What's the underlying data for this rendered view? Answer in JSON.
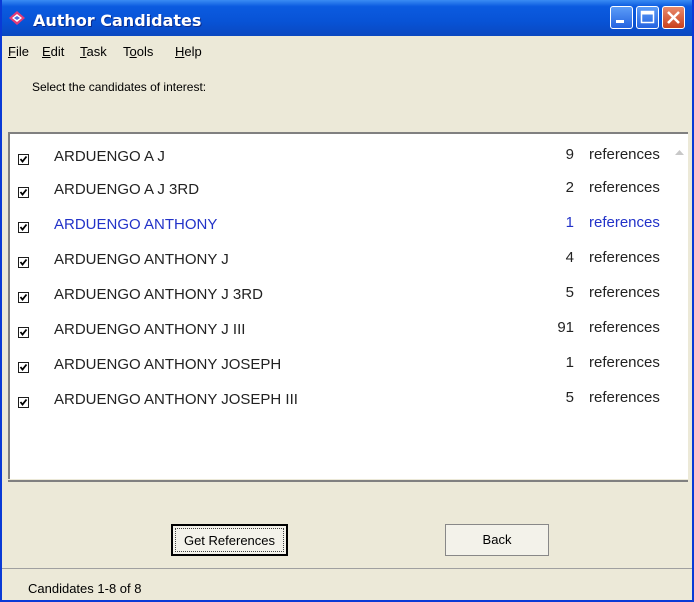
{
  "window": {
    "title": "Author Candidates"
  },
  "menu": [
    {
      "key": "F",
      "rest": "ile"
    },
    {
      "key": "E",
      "rest": "dit"
    },
    {
      "key": "T",
      "rest": "ask"
    },
    {
      "pre": "T",
      "key": "o",
      "rest": "ols"
    },
    {
      "key": "H",
      "rest": "elp"
    }
  ],
  "instruction": "Select the candidates of interest:",
  "candidates": [
    {
      "name": "ARDUENGO A J",
      "count": "9",
      "unit": "references",
      "checked": true
    },
    {
      "name": "ARDUENGO A J 3RD",
      "count": "2",
      "unit": "references",
      "checked": true
    },
    {
      "name": "ARDUENGO ANTHONY",
      "count": "1",
      "unit": "references",
      "checked": true,
      "highlight": true
    },
    {
      "name": "ARDUENGO ANTHONY J",
      "count": "4",
      "unit": "references",
      "checked": true
    },
    {
      "name": "ARDUENGO ANTHONY J 3RD",
      "count": "5",
      "unit": "references",
      "checked": true
    },
    {
      "name": "ARDUENGO ANTHONY J III",
      "count": "91",
      "unit": "references",
      "checked": true
    },
    {
      "name": "ARDUENGO ANTHONY JOSEPH",
      "count": "1",
      "unit": "references",
      "checked": true
    },
    {
      "name": "ARDUENGO ANTHONY JOSEPH III",
      "count": "5",
      "unit": "references",
      "checked": true
    }
  ],
  "buttons": {
    "get_references": "Get References",
    "back": "Back"
  },
  "status": "Candidates 1-8 of 8",
  "colors": {
    "highlight_text": "#2232c8",
    "titlebar": "#0853d6"
  }
}
